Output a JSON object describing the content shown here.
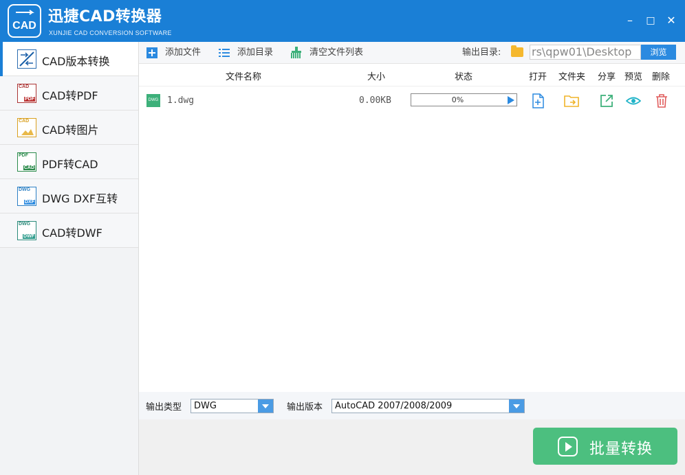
{
  "app": {
    "title": "迅捷CAD转换器",
    "subtitle": "XUNJIE CAD CONVERSION SOFTWARE",
    "logo_text": "CAD"
  },
  "window_controls": {
    "minimize": "–",
    "maximize": "□",
    "close": "✕"
  },
  "sidebar": {
    "items": [
      {
        "label": "CAD版本转换",
        "icon": "cad-version-icon",
        "icon_top": "",
        "icon_bottom": "",
        "active": true
      },
      {
        "label": "CAD转PDF",
        "icon": "cad-to-pdf-icon",
        "icon_top": "CAD",
        "icon_bottom": "PDF"
      },
      {
        "label": "CAD转图片",
        "icon": "cad-to-image-icon",
        "icon_top": "CAD",
        "icon_bottom": ""
      },
      {
        "label": "PDF转CAD",
        "icon": "pdf-to-cad-icon",
        "icon_top": "PDF",
        "icon_bottom": "CAD"
      },
      {
        "label": "DWG DXF互转",
        "icon": "dwg-dxf-icon",
        "icon_top": "DWG",
        "icon_bottom": "DXF"
      },
      {
        "label": "CAD转DWF",
        "icon": "cad-to-dwf-icon",
        "icon_top": "DWG",
        "icon_bottom": "DWF"
      }
    ]
  },
  "toolbar": {
    "add_file": "添加文件",
    "add_dir": "添加目录",
    "clear_list": "清空文件列表",
    "output_dir_label": "输出目录:",
    "output_path": "rs\\qpw01\\Desktop",
    "browse": "浏览"
  },
  "table": {
    "headers": {
      "name": "文件名称",
      "size": "大小",
      "status": "状态",
      "open": "打开",
      "folder": "文件夹",
      "share": "分享",
      "preview": "预览",
      "delete": "删除"
    },
    "rows": [
      {
        "type_badge": "DWG",
        "name": "1.dwg",
        "size": "0.00KB",
        "progress_text": "0%",
        "progress": 0
      }
    ]
  },
  "options": {
    "output_type_label": "输出类型",
    "output_type_value": "DWG",
    "output_version_label": "输出版本",
    "output_version_value": "AutoCAD 2007/2008/2009"
  },
  "convert_button": "批量转换",
  "colors": {
    "accent": "#1a7fd6",
    "convert": "#4cbf7f",
    "open_icon": "#2b8ae0",
    "folder_icon": "#f0b429",
    "share_icon": "#3db07a",
    "preview_icon": "#1fb3c8",
    "delete_icon": "#e05b5b"
  }
}
